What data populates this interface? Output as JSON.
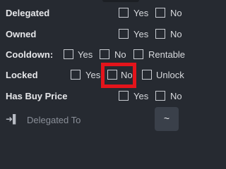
{
  "filters": {
    "delegated": {
      "label": "Delegated",
      "options": [
        "Yes",
        "No"
      ]
    },
    "owned": {
      "label": "Owned",
      "options": [
        "Yes",
        "No"
      ]
    },
    "cooldown": {
      "label": "Cooldown:",
      "options": [
        "Yes",
        "No",
        "Rentable"
      ]
    },
    "locked": {
      "label": "Locked",
      "options": [
        "Yes",
        "No",
        "Unlock"
      ],
      "highlighted_option": "No"
    },
    "has_buy_price": {
      "label": "Has Buy Price",
      "options": [
        "Yes",
        "No"
      ]
    }
  },
  "delegated_to": {
    "icon": "login-arrow-icon",
    "placeholder": "Delegated To",
    "button_label": "~"
  },
  "colors": {
    "background": "#262a31",
    "highlight": "#e4141b",
    "button_bg": "#3a404a"
  }
}
